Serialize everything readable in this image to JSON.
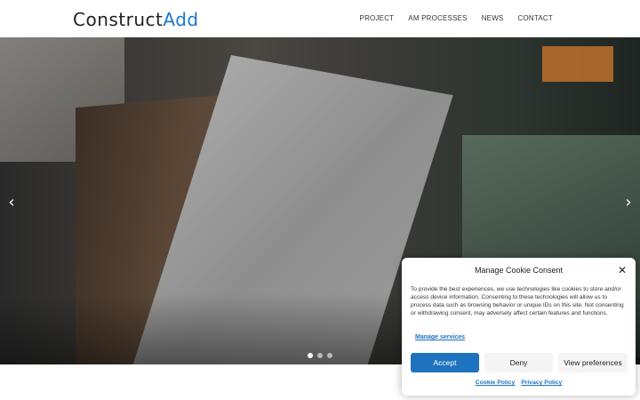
{
  "header": {
    "logo_main": "Construct",
    "logo_accent": "Add",
    "nav": [
      "PROJECT",
      "AM PROCESSES",
      "NEWS",
      "CONTACT"
    ]
  },
  "slider": {
    "prev_icon": "‹",
    "next_icon": "›",
    "slide_count": 3,
    "active_slide": 1
  },
  "cookie": {
    "title": "Manage Cookie Consent",
    "close_icon": "✕",
    "body": "To provide the best experiences, we use technologies like cookies to store and/or access device information. Consenting to these technologies will allow us to process data such as browsing behavior or unique IDs on this site. Not consenting or withdrawing consent, may adversely affect certain features and functions.",
    "manage_services": "Manage services",
    "accept": "Accept",
    "deny": "Deny",
    "view_preferences": "View preferences",
    "cookie_policy": "Cookie Policy",
    "privacy_policy": "Privacy Policy"
  },
  "colors": {
    "accent": "#1e73be",
    "logo_accent": "#1a75c9"
  }
}
